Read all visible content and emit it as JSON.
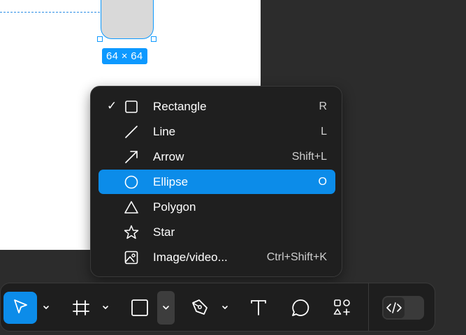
{
  "canvas": {
    "dimension_label": "64 × 64"
  },
  "shape_menu": {
    "items": [
      {
        "label": "Rectangle",
        "shortcut": "R",
        "icon": "rectangle-icon",
        "checked": true,
        "highlighted": false
      },
      {
        "label": "Line",
        "shortcut": "L",
        "icon": "line-icon",
        "checked": false,
        "highlighted": false
      },
      {
        "label": "Arrow",
        "shortcut": "Shift+L",
        "icon": "arrow-icon",
        "checked": false,
        "highlighted": false
      },
      {
        "label": "Ellipse",
        "shortcut": "O",
        "icon": "ellipse-icon",
        "checked": false,
        "highlighted": true
      },
      {
        "label": "Polygon",
        "shortcut": "",
        "icon": "polygon-icon",
        "checked": false,
        "highlighted": false
      },
      {
        "label": "Star",
        "shortcut": "",
        "icon": "star-icon",
        "checked": false,
        "highlighted": false
      },
      {
        "label": "Image/video...",
        "shortcut": "Ctrl+Shift+K",
        "icon": "image-icon",
        "checked": false,
        "highlighted": false
      }
    ],
    "check_glyph": "✓"
  },
  "toolbar": {
    "tools": [
      "move-tool",
      "frame-tool",
      "shape-tool",
      "pen-tool",
      "text-tool",
      "comment-tool",
      "actions-tool",
      "dev-mode-toggle"
    ],
    "active_tool": "move-tool"
  },
  "colors": {
    "accent": "#0c8ce9",
    "selection": "#0d99ff",
    "menu_bg": "#1f1f1f",
    "toolbar_bg": "#1e1e1e"
  }
}
